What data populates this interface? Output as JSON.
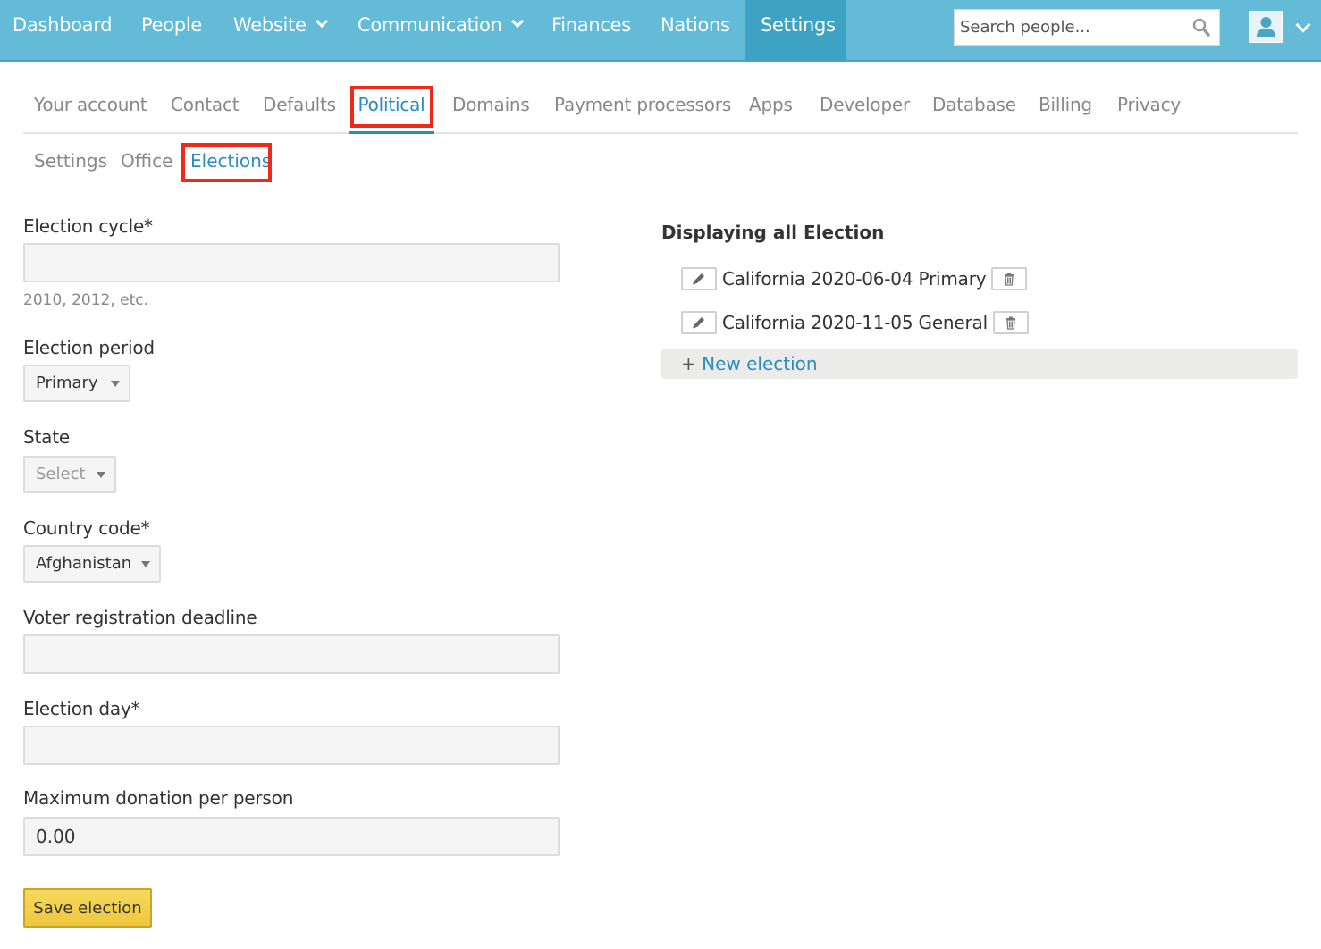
{
  "nav": {
    "items": [
      {
        "label": "Dashboard"
      },
      {
        "label": "People"
      },
      {
        "label": "Website"
      },
      {
        "label": "Communication"
      },
      {
        "label": "Finances"
      },
      {
        "label": "Nations"
      },
      {
        "label": "Settings"
      }
    ],
    "search_placeholder": "Search people...",
    "colors": {
      "bar": "#63bbd8",
      "active": "#3ea2c2"
    }
  },
  "tabs": [
    {
      "label": "Your account"
    },
    {
      "label": "Contact"
    },
    {
      "label": "Defaults"
    },
    {
      "label": "Political"
    },
    {
      "label": "Domains"
    },
    {
      "label": "Payment processors"
    },
    {
      "label": "Apps"
    },
    {
      "label": "Developer"
    },
    {
      "label": "Database"
    },
    {
      "label": "Billing"
    },
    {
      "label": "Privacy"
    }
  ],
  "subtabs": [
    {
      "label": "Settings"
    },
    {
      "label": "Office"
    },
    {
      "label": "Elections"
    }
  ],
  "form": {
    "election_cycle": {
      "label": "Election cycle*",
      "value": "",
      "hint": "2010, 2012, etc."
    },
    "election_period": {
      "label": "Election period",
      "value": "Primary"
    },
    "state": {
      "label": "State",
      "value": "Select"
    },
    "country_code": {
      "label": "Country code*",
      "value": "Afghanistan"
    },
    "voter_registration_deadline": {
      "label": "Voter registration deadline",
      "value": ""
    },
    "election_day": {
      "label": "Election day*",
      "value": ""
    },
    "max_donation": {
      "label": "Maximum donation per person",
      "value": "0.00"
    },
    "save_label": "Save election"
  },
  "elections_list": {
    "title": "Displaying all Election",
    "items": [
      {
        "name": "California 2020-06-04 Primary"
      },
      {
        "name": "California 2020-11-05 General"
      }
    ],
    "new_plus": "+",
    "new_label": "New election"
  },
  "highlight_color": "#ee2b1a",
  "accent_color": "#2b8cc0",
  "button_color": "#eec73e"
}
